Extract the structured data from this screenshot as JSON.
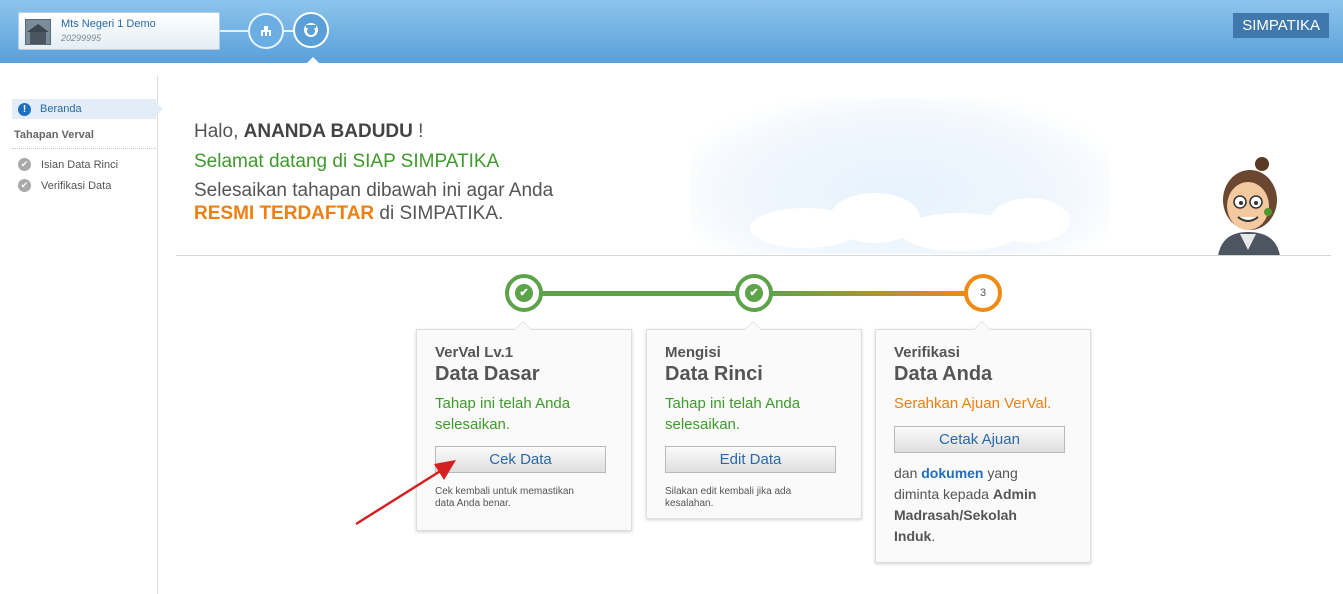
{
  "header": {
    "school_name": "Mts Negeri 1 Demo",
    "school_code": "20299995",
    "brand": "SIMPATIKA",
    "nav_icons": [
      "building-icon",
      "user-icon"
    ]
  },
  "sidebar": {
    "home_label": "Beranda",
    "section_title": "Tahapan Verval",
    "items": [
      {
        "label": "Isian Data Rinci",
        "icon": "check-circle-icon"
      },
      {
        "label": "Verifikasi Data",
        "icon": "check-circle-icon"
      }
    ]
  },
  "welcome": {
    "greeting_prefix": "Halo, ",
    "user_name": "ANANDA BADUDU",
    "greeting_suffix": " !",
    "welcome_line": "Selamat datang di SIAP SIMPATIKA",
    "instruction_line1": "Selesaikan tahapan dibawah ini agar Anda",
    "instruction_highlight": "RESMI TERDAFTAR",
    "instruction_suffix": " di SIMPATIKA."
  },
  "progress": {
    "steps": [
      {
        "state": "done",
        "icon": "check-icon"
      },
      {
        "state": "done",
        "icon": "check-icon"
      },
      {
        "state": "current",
        "number": "3"
      }
    ],
    "colors": {
      "done": "#5ea24a",
      "current": "#f08a12"
    }
  },
  "cards": [
    {
      "small_title": "VerVal Lv.1",
      "big_title": "Data Dasar",
      "msg_line1": "Tahap ini telah Anda",
      "msg_line2": "selesaikan.",
      "button": "Cek Data",
      "note_line1": "Cek kembali untuk memastikan",
      "note_line2": "data Anda benar."
    },
    {
      "small_title": "Mengisi",
      "big_title": "Data Rinci",
      "msg_line1": "Tahap ini telah Anda",
      "msg_line2": "selesaikan.",
      "button": "Edit Data",
      "note_line1": "Silakan edit kembali jika ada",
      "note_line2": "kesalahan."
    },
    {
      "small_title": "Verifikasi",
      "big_title": "Data Anda",
      "msg_line1": "Serahkan Ajuan VerVal.",
      "button": "Cetak Ajuan",
      "extra_1": "dan ",
      "extra_link": "dokumen",
      "extra_2": " yang",
      "extra_3": "diminta kepada ",
      "extra_bold_1": "Admin",
      "extra_bold_2": "Madrasah/Sekolah",
      "extra_bold_3": "Induk",
      "extra_end": "."
    }
  ]
}
